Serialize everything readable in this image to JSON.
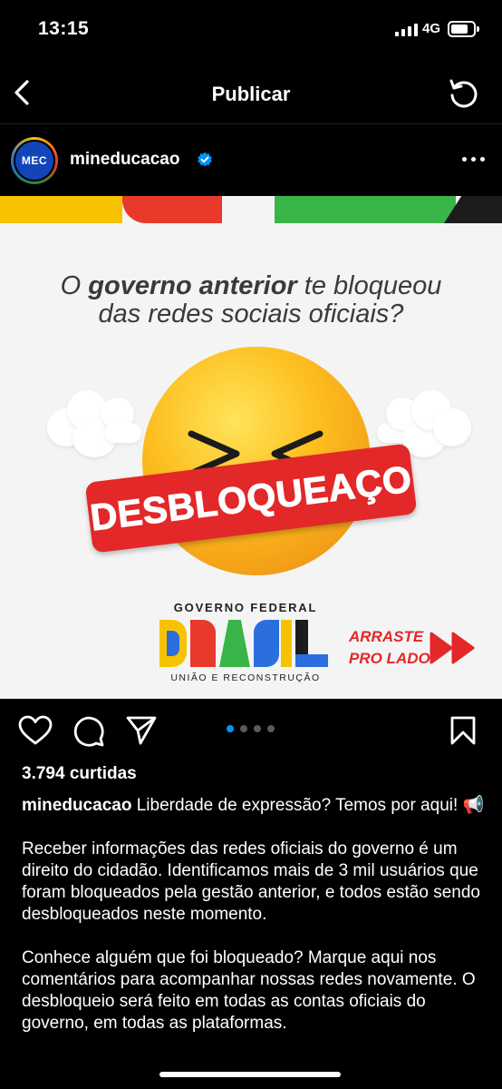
{
  "status": {
    "time": "13:15",
    "network": "4G"
  },
  "nav": {
    "title": "Publicar"
  },
  "post": {
    "username": "mineducacao",
    "avatar_text": "MEC",
    "image": {
      "headline_pre": "O ",
      "headline_bold": "governo anterior",
      "headline_post": " te bloqueou",
      "headline_line2": "das redes sociais oficiais?",
      "banner": "DESBLOQUEAÇO",
      "gov_label": "GOVERNO FEDERAL",
      "gov_motto": "UNIÃO E RECONSTRUÇÃO",
      "swipe_line1": "ARRASTE",
      "swipe_line2": "PRO LADO",
      "stripe_colors": [
        "#f7c300",
        "#e8392a",
        "#ffffff",
        "#38b449",
        "#1c1c1c"
      ]
    },
    "carousel": {
      "count": 4,
      "active": 0
    },
    "likes": "3.794 curtidas",
    "caption": {
      "username": "mineducacao",
      "first": " Liberdade de expressão? Temos por aqui! 📢",
      "p2": "Receber informações das redes oficiais do governo é um direito do cidadão. Identificamos mais de 3 mil usuários que foram bloqueados pela gestão anterior, e todos estão sendo desbloqueados neste momento.",
      "p3": "Conhece alguém que foi bloqueado? Marque aqui nos comentários para acompanhar nossas redes novamente. O desbloqueio será feito em todas as contas oficiais do governo, em todas as plataformas."
    }
  },
  "icons": {
    "back": "chevron-left-icon",
    "refresh": "refresh-icon",
    "verified": "verified-badge-icon",
    "more": "more-dots-icon",
    "like": "heart-icon",
    "comment": "comment-icon",
    "share": "send-icon",
    "save": "bookmark-icon"
  },
  "colors": {
    "accent": "#0095f6",
    "banner": "#e22828"
  }
}
